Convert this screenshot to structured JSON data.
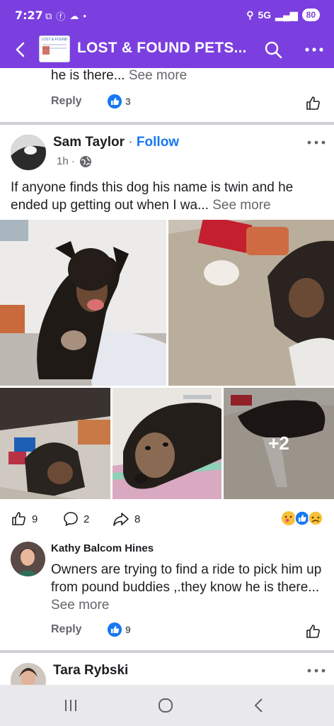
{
  "status_bar": {
    "time": "7:27",
    "network": "5G",
    "battery": "80"
  },
  "app_bar": {
    "title": "LOST & FOUND PETS...",
    "group_thumb_text": "LOST & FOUND"
  },
  "previous_comment": {
    "text": "he is there...",
    "see_more": "See more",
    "reply": "Reply",
    "likes": "3"
  },
  "post": {
    "author": "Sam Taylor",
    "separator": "·",
    "follow": "Follow",
    "time": "1h ·",
    "text": "If anyone finds this dog his name is twin and he ended up getting out when I wa...",
    "see_more": "See more",
    "more_photos": "+2",
    "likes": "9",
    "comments": "2",
    "shares": "8"
  },
  "comment": {
    "author": "Kathy Balcom Hines",
    "text": "Owners are trying to find a ride to pick him up from pound buddies ,.they know he is there...",
    "see_more": "See more",
    "reply": "Reply",
    "likes": "9"
  },
  "next_post": {
    "author": "Tara Rybski"
  },
  "colors": {
    "header": "#7b3fe0",
    "link": "#1877f2",
    "muted": "#65676b",
    "divider": "#ced0d4"
  },
  "icons": [
    "back-arrow-icon",
    "search-icon",
    "more-dots-icon",
    "globe-icon",
    "like-icon",
    "comment-icon",
    "share-icon",
    "reactions-icon",
    "nav-recents-icon",
    "nav-home-icon",
    "nav-back-icon"
  ]
}
